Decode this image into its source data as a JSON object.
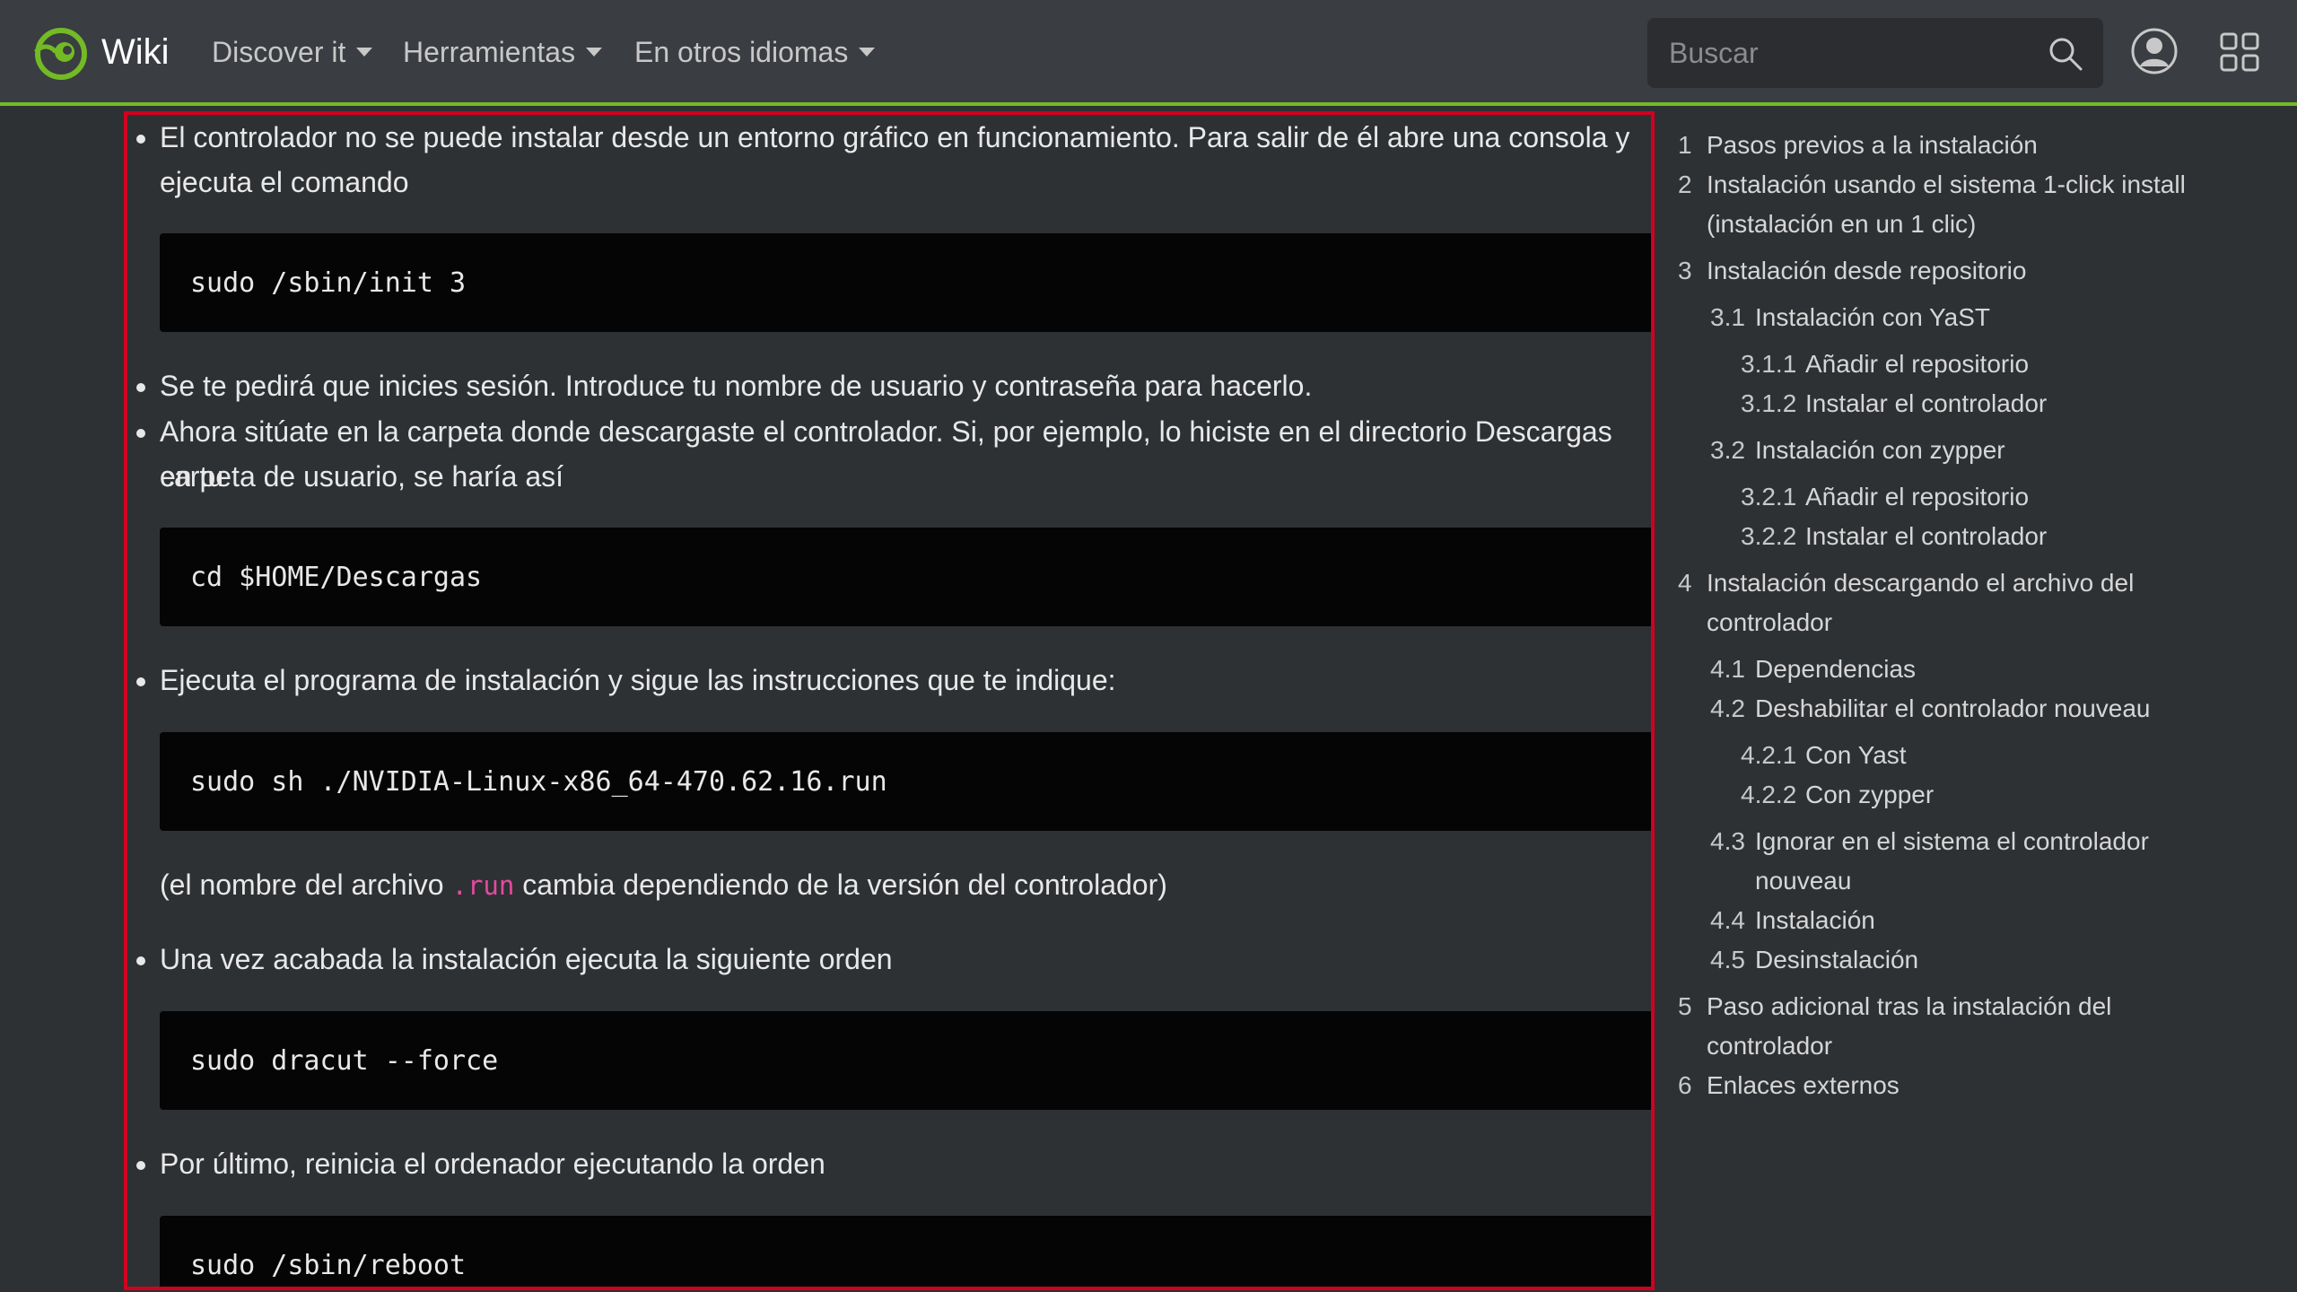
{
  "nav": {
    "brand": "Wiki",
    "menus": [
      {
        "label": "Discover it"
      },
      {
        "label": "Herramientas"
      },
      {
        "label": "En otros idiomas"
      }
    ],
    "search_placeholder": "Buscar",
    "accent_color": "#73ba25"
  },
  "content": {
    "p1_line1": "El controlador no se puede instalar desde un entorno gráfico en funcionamiento. Para salir de él abre una consola y",
    "p1_line2": "ejecuta el comando",
    "code1": "sudo /sbin/init 3",
    "p2": "Se te pedirá que inicies sesión. Introduce tu nombre de usuario y contraseña para hacerlo.",
    "p3_line1": "Ahora sitúate en la carpeta donde descargaste el controlador. Si, por ejemplo, lo hiciste en el directorio Descargas en tu",
    "p3_line2": "carpeta de usuario, se haría así",
    "code2": "cd $HOME/Descargas",
    "p4": "Ejecuta el programa de instalación y sigue las instrucciones que te indique:",
    "code3": "sudo sh ./NVIDIA-Linux-x86_64-470.62.16.run",
    "note_before": "(el nombre del archivo ",
    "note_code": ".run",
    "note_after": " cambia dependiendo de la versión del controlador)",
    "p5": "Una vez acabada la instalación ejecuta la siguiente orden",
    "code4": "sudo dracut --force",
    "p6": "Por último, reinicia el ordenador ejecutando la orden",
    "code5": "sudo /sbin/reboot"
  },
  "toc": [
    {
      "num": "1",
      "text": "Pasos previos a la instalación"
    },
    {
      "num": "2",
      "text": "Instalación usando el sistema 1-click install"
    },
    {
      "num": "",
      "text": "(instalación en un 1 clic)"
    },
    {
      "num": "3",
      "text": "Instalación desde repositorio"
    },
    {
      "num": "3.1",
      "text": "Instalación con YaST"
    },
    {
      "num": "3.1.1",
      "text": "Añadir el repositorio"
    },
    {
      "num": "3.1.2",
      "text": "Instalar el controlador"
    },
    {
      "num": "3.2",
      "text": "Instalación con zypper"
    },
    {
      "num": "3.2.1",
      "text": "Añadir el repositorio"
    },
    {
      "num": "3.2.2",
      "text": "Instalar el controlador"
    },
    {
      "num": "4",
      "text": "Instalación descargando el archivo del"
    },
    {
      "num": "",
      "text": "controlador"
    },
    {
      "num": "4.1",
      "text": "Dependencias"
    },
    {
      "num": "4.2",
      "text": "Deshabilitar el controlador nouveau"
    },
    {
      "num": "4.2.1",
      "text": "Con Yast"
    },
    {
      "num": "4.2.2",
      "text": "Con zypper"
    },
    {
      "num": "4.3",
      "text": "Ignorar en el sistema el controlador"
    },
    {
      "num": "",
      "text": "nouveau"
    },
    {
      "num": "4.4",
      "text": "Instalación"
    },
    {
      "num": "4.5",
      "text": "Desinstalación"
    },
    {
      "num": "5",
      "text": "Paso adicional tras la instalación del"
    },
    {
      "num": "",
      "text": "controlador"
    },
    {
      "num": "6",
      "text": "Enlaces externos"
    }
  ]
}
